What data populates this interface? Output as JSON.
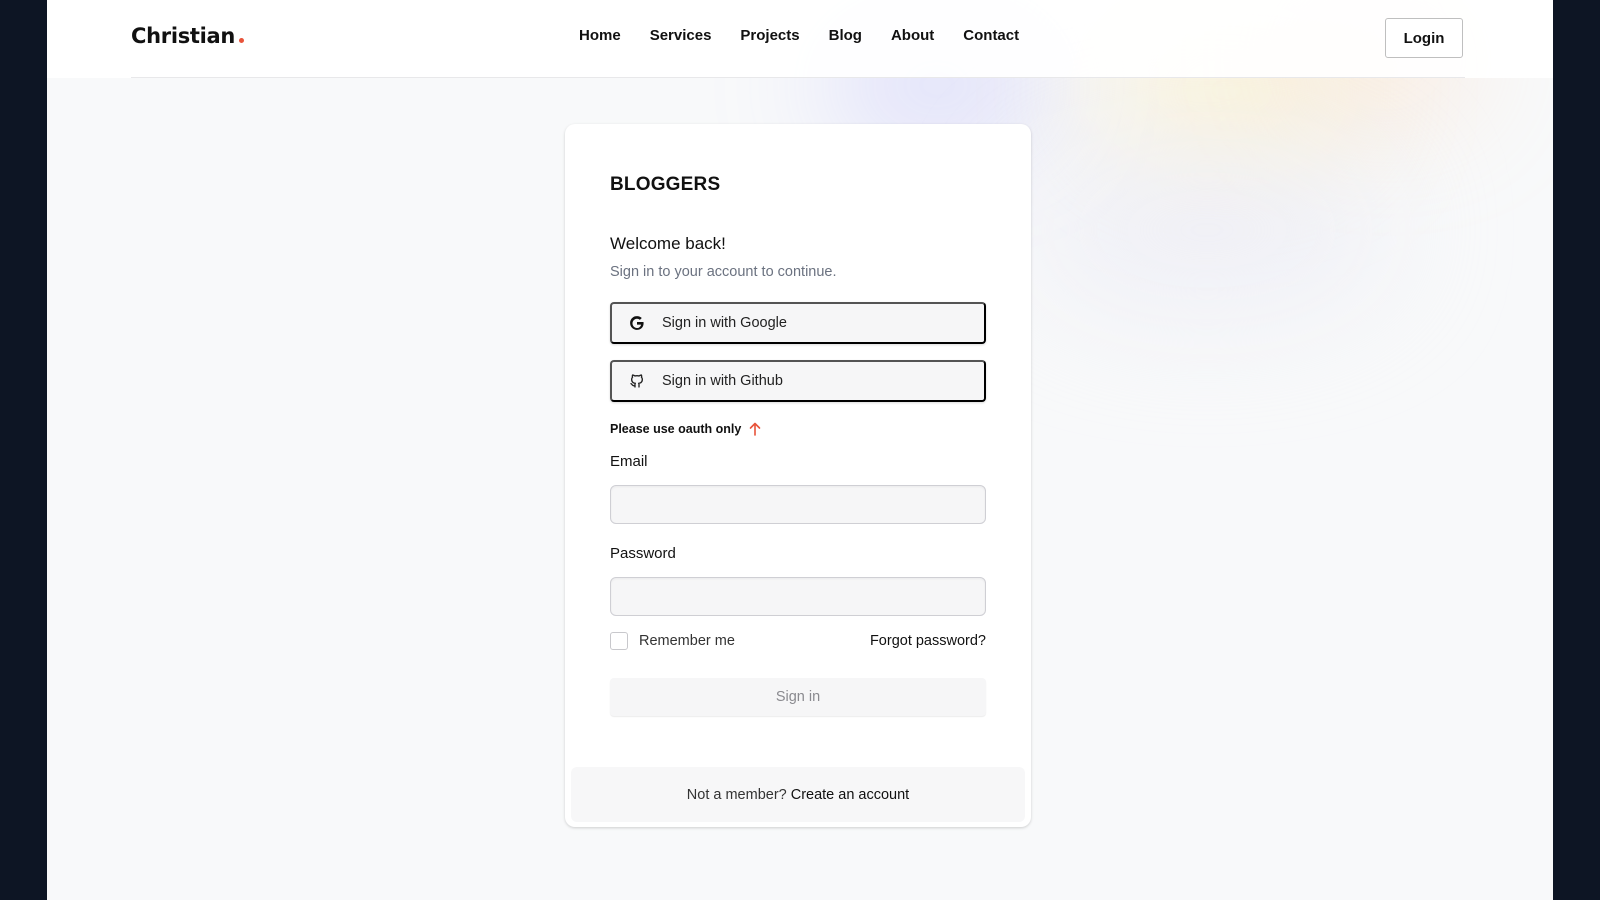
{
  "header": {
    "logo": "Christian",
    "nav": [
      "Home",
      "Services",
      "Projects",
      "Blog",
      "About",
      "Contact"
    ],
    "login_label": "Login"
  },
  "card": {
    "brand": "BLOGGERS",
    "welcome": "Welcome back!",
    "subtitle": "Sign in to your account to continue.",
    "google_label": "Sign in with Google",
    "github_label": "Sign in with Github",
    "oauth_note": "Please use oauth only",
    "email_label": "Email",
    "email_value": "",
    "email_placeholder": "",
    "password_label": "Password",
    "password_value": "",
    "password_placeholder": "",
    "remember_label": "Remember me",
    "forgot_label": "Forgot password?",
    "signin_label": "Sign in",
    "footer_text": "Not a member?",
    "footer_link": "Create an account"
  },
  "colors": {
    "accent": "#e8533a",
    "page_bg": "#f8f9fa",
    "outer_bg": "#0d1524"
  },
  "icons": {
    "google": "google-icon",
    "github": "github-icon",
    "arrow": "arrow-up-icon"
  }
}
